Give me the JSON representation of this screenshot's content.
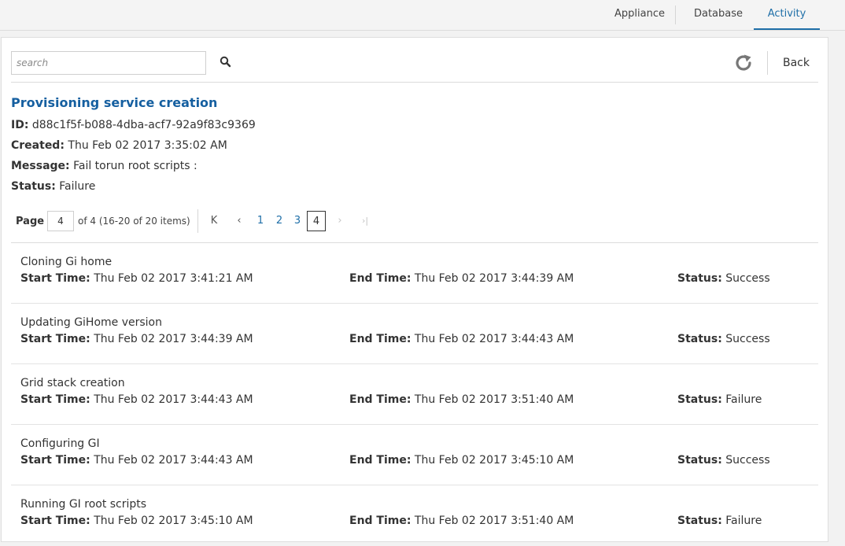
{
  "nav": {
    "tabs": [
      {
        "label": "Appliance",
        "active": false
      },
      {
        "label": "Database",
        "active": false
      },
      {
        "label": "Activity",
        "active": true
      }
    ]
  },
  "toolbar": {
    "search_placeholder": "search",
    "search_value": "",
    "search_icon": "search-icon",
    "refresh_icon": "refresh-icon",
    "back_label": "Back"
  },
  "job": {
    "title": "Provisioning service creation",
    "id_label": "ID:",
    "id_value": "d88c1f5f-b088-4dba-acf7-92a9f83c9369",
    "created_label": "Created:",
    "created_value": "Thu Feb 02 2017 3:35:02 AM",
    "message_label": "Message:",
    "message_value": "Fail torun root scripts :",
    "status_label": "Status:",
    "status_value": "Failure"
  },
  "pager": {
    "label": "Page",
    "current": "4",
    "info": "of 4 (16-20 of 20 items)",
    "first": "K",
    "prev": "‹",
    "next": "›",
    "last": "›|",
    "pages": [
      "1",
      "2",
      "3",
      "4"
    ]
  },
  "task_labels": {
    "start": "Start Time:",
    "end": "End Time:",
    "status": "Status:"
  },
  "tasks": [
    {
      "name": "Cloning Gi home",
      "start": "Thu Feb 02 2017 3:41:21 AM",
      "end": "Thu Feb 02 2017 3:44:39 AM",
      "status": "Success"
    },
    {
      "name": "Updating GiHome version",
      "start": "Thu Feb 02 2017 3:44:39 AM",
      "end": "Thu Feb 02 2017 3:44:43 AM",
      "status": "Success"
    },
    {
      "name": "Grid stack creation",
      "start": "Thu Feb 02 2017 3:44:43 AM",
      "end": "Thu Feb 02 2017 3:51:40 AM",
      "status": "Failure"
    },
    {
      "name": "Configuring GI",
      "start": "Thu Feb 02 2017 3:44:43 AM",
      "end": "Thu Feb 02 2017 3:45:10 AM",
      "status": "Success"
    },
    {
      "name": "Running GI root scripts",
      "start": "Thu Feb 02 2017 3:45:10 AM",
      "end": "Thu Feb 02 2017 3:51:40 AM",
      "status": "Failure"
    }
  ]
}
